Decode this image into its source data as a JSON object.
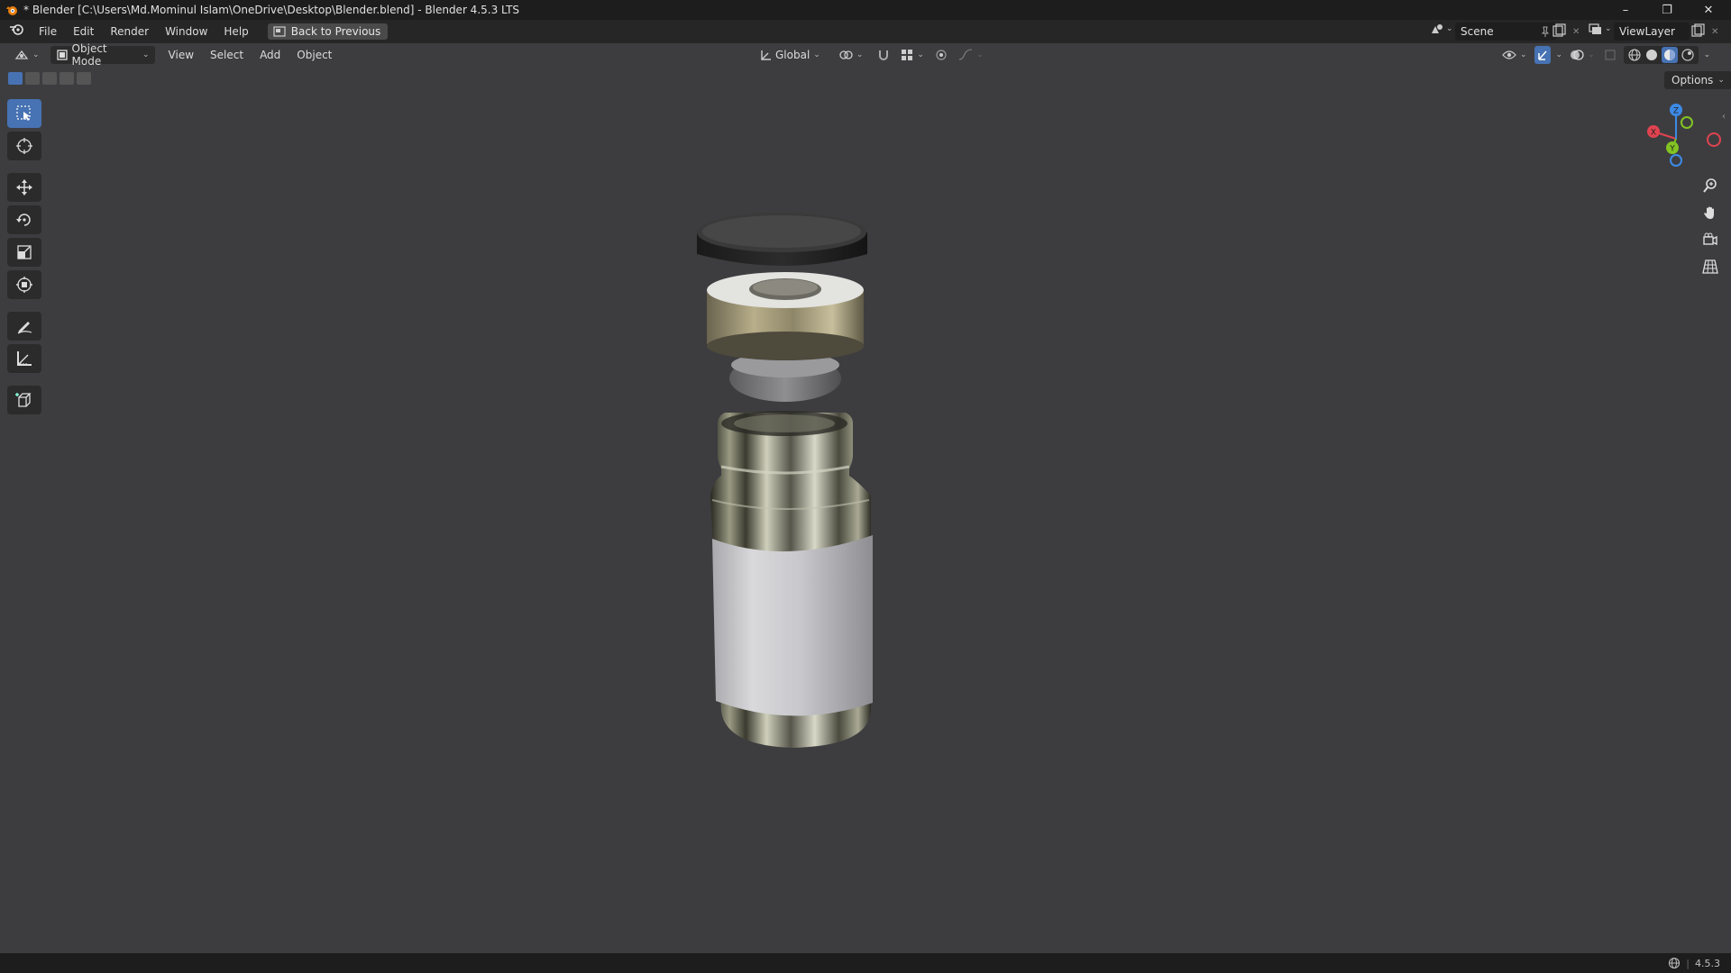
{
  "window": {
    "title": "* Blender [C:\\Users\\Md.Mominul Islam\\OneDrive\\Desktop\\Blender.blend] - Blender 4.5.3 LTS",
    "minimize": "–",
    "maximize": "❐",
    "close": "✕"
  },
  "menubar": {
    "items": [
      "File",
      "Edit",
      "Render",
      "Window",
      "Help"
    ],
    "back_button": "Back to Previous",
    "scene_label": "Scene",
    "view_layer_label": "ViewLayer"
  },
  "viewport_header": {
    "mode": "Object Mode",
    "menus": [
      "View",
      "Select",
      "Add",
      "Object"
    ],
    "transform_orientation": "Global",
    "options_label": "Options"
  },
  "toolbar": {
    "tools": [
      "select-box",
      "cursor",
      "move",
      "rotate",
      "scale",
      "transform",
      "annotate",
      "measure",
      "add-cube"
    ],
    "active_tool": "select-box"
  },
  "gizmo": {
    "axes": [
      "X",
      "Y",
      "Z"
    ],
    "colors": {
      "x": "#e0434f",
      "y": "#83c323",
      "z": "#3d8ae6"
    }
  },
  "statusbar": {
    "version": "4.5.3"
  },
  "colors": {
    "accent": "#4772b3",
    "viewport_bg": "#3d3d40"
  }
}
